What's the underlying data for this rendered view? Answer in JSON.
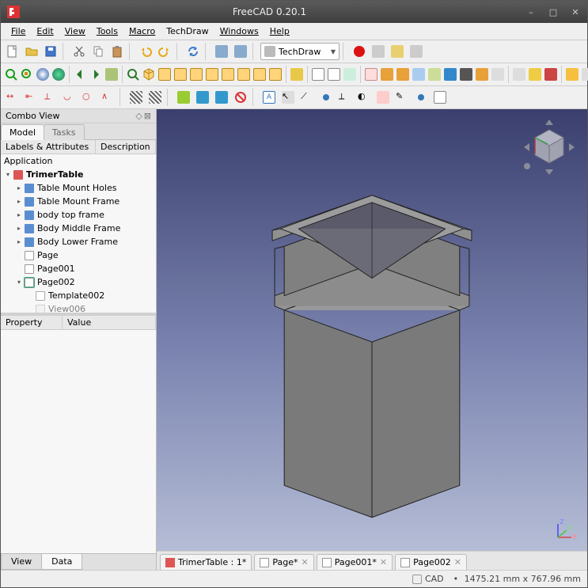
{
  "title": "FreeCAD 0.20.1",
  "menu": {
    "file": "File",
    "edit": "Edit",
    "view": "View",
    "tools": "Tools",
    "macro": "Macro",
    "techdraw": "TechDraw",
    "windows": "Windows",
    "help": "Help"
  },
  "workbench": {
    "selected": "TechDraw"
  },
  "combo": {
    "title": "Combo View",
    "tabs": {
      "model": "Model",
      "tasks": "Tasks"
    },
    "columns": {
      "labels": "Labels & Attributes",
      "desc": "Description"
    },
    "tree": {
      "root": "Application",
      "doc": "TrimerTable",
      "items": [
        {
          "label": "Table Mount Holes",
          "icon": "body"
        },
        {
          "label": "Table Mount Frame",
          "icon": "body"
        },
        {
          "label": "body top frame",
          "icon": "body"
        },
        {
          "label": "Body Middle Frame",
          "icon": "body"
        },
        {
          "label": "Body Lower Frame",
          "icon": "body"
        },
        {
          "label": "Page",
          "icon": "page"
        },
        {
          "label": "Page001",
          "icon": "page"
        }
      ],
      "expanded": {
        "label": "Page002",
        "icon": "page-active",
        "children": [
          {
            "label": "Template002",
            "icon": "template"
          },
          {
            "label": "View006",
            "icon": "view"
          }
        ]
      }
    },
    "prop_columns": {
      "prop": "Property",
      "val": "Value"
    },
    "prop_tabs": {
      "view": "View",
      "data": "Data"
    }
  },
  "doc_tabs": [
    {
      "label": "TrimerTable : 1*",
      "icon": "doc-3d"
    },
    {
      "label": "Page*",
      "icon": "doc-page",
      "closable": true
    },
    {
      "label": "Page001*",
      "icon": "doc-page",
      "closable": true
    },
    {
      "label": "Page002",
      "icon": "doc-page",
      "closable": true
    }
  ],
  "status": {
    "mode": "CAD",
    "dims": "1475.21 mm x 767.96 mm"
  }
}
